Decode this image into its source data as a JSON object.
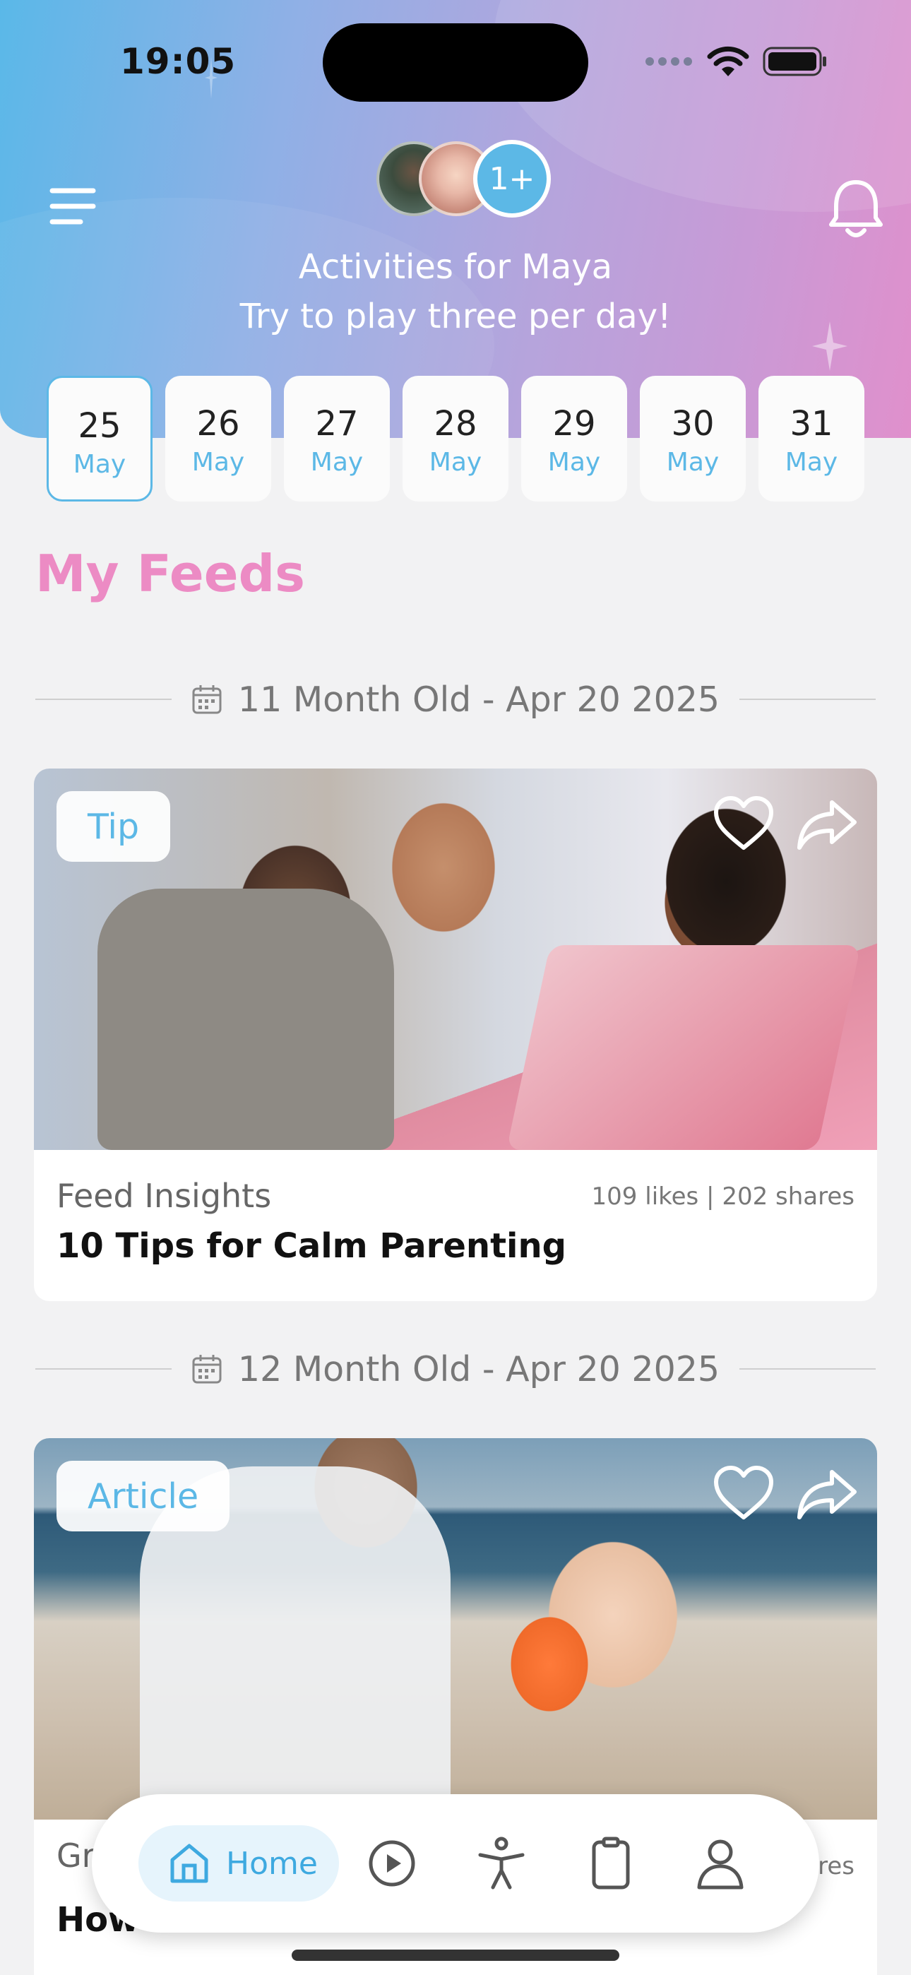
{
  "status_bar": {
    "time": "19:05"
  },
  "header": {
    "title": "Activities for Maya",
    "subtitle": "Try to play three per day!",
    "avatars_more": "1+"
  },
  "dates": [
    {
      "day": "25",
      "month": "May",
      "selected": true
    },
    {
      "day": "26",
      "month": "May"
    },
    {
      "day": "27",
      "month": "May"
    },
    {
      "day": "28",
      "month": "May"
    },
    {
      "day": "29",
      "month": "May"
    },
    {
      "day": "30",
      "month": "May"
    },
    {
      "day": "31",
      "month": "May"
    }
  ],
  "feeds_title": "My Feeds",
  "feeds": [
    {
      "date_label": "11 Month Old - Apr 20 2025",
      "tag": "Tip",
      "category": "Feed Insights",
      "stats": "109 likes | 202 shares",
      "title": "10 Tips for Calm Parenting"
    },
    {
      "date_label": "12 Month Old - Apr 20 2025",
      "tag": "Article",
      "category": "Gr",
      "stats": "res",
      "title": "How"
    }
  ],
  "nav": {
    "home_label": "Home"
  },
  "colors": {
    "accent": "#5cb8e6",
    "pink": "#ec8bc4"
  }
}
